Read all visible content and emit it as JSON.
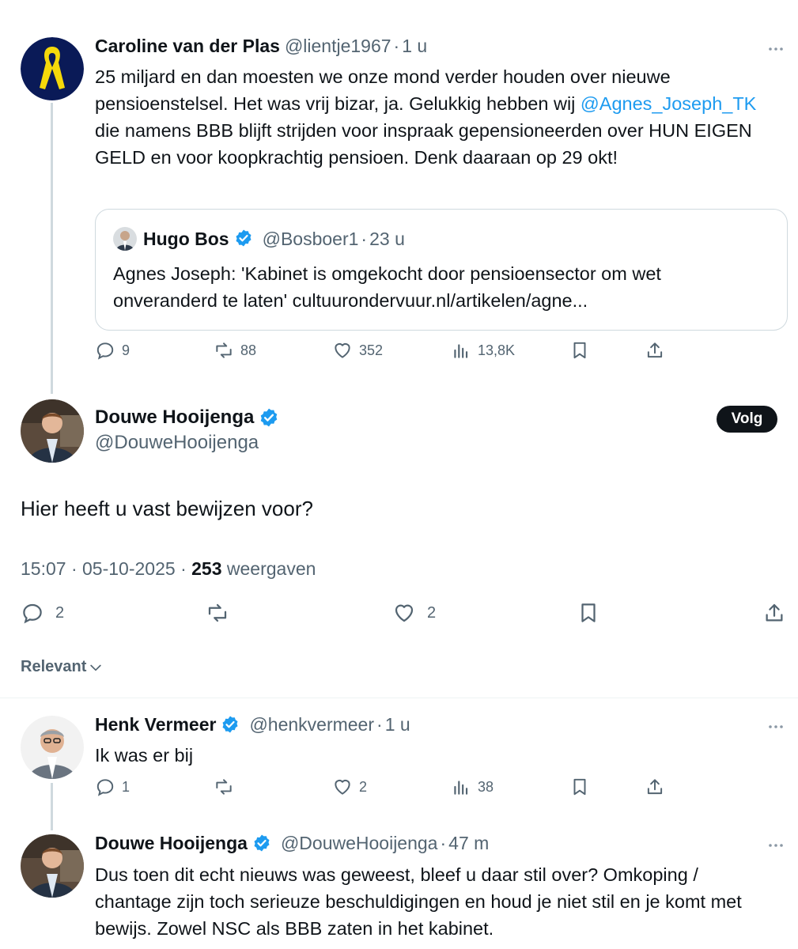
{
  "colors": {
    "accent": "#1d9bf0",
    "text": "#0f1419",
    "muted": "#536471",
    "border": "#cfd9de"
  },
  "post1": {
    "name": "Caroline van der Plas",
    "handle": "@lientje1967",
    "time": "1 u",
    "text_a": "25 miljard en dan moesten we onze mond verder houden over nieuwe pensioenstelsel. Het was vrij bizar, ja. Gelukkig hebben wij ",
    "mention": "@Agnes_Joseph_TK",
    "text_b": " die namens BBB blijft strijden voor inspraak gepensioneerden over HUN EIGEN GELD en voor koopkrachtig pensioen. Denk daaraan op 29 okt!",
    "quote": {
      "name": "Hugo Bos",
      "handle": "@Bosboer1",
      "time": "23 u",
      "text": "Agnes Joseph: 'Kabinet is omgekocht door pensioensector om wet onveranderd te laten'  cultuurondervuur.nl/artikelen/agne..."
    },
    "replies": "9",
    "reposts": "88",
    "likes": "352",
    "views": "13,8K"
  },
  "main_post": {
    "name": "Douwe Hooijenga",
    "handle": "@DouweHooijenga",
    "follow_label": "Volg",
    "text": "Hier heeft u vast bewijzen voor?",
    "time": "15:07",
    "date": "05-10-2025",
    "views_count": "253",
    "views_label": "weergaven",
    "replies": "2",
    "likes": "2"
  },
  "sort": {
    "label": "Relevant"
  },
  "reply1": {
    "name": "Henk Vermeer",
    "handle": "@henkvermeer",
    "time": "1 u",
    "text": "Ik was er bij",
    "replies": "1",
    "likes": "2",
    "views": "38"
  },
  "reply2": {
    "name": "Douwe Hooijenga",
    "handle": "@DouweHooijenga",
    "time": "47 m",
    "text": "Dus toen dit echt nieuws was geweest, bleef u daar stil over? Omkoping / chantage zijn toch serieuze beschuldigingen en houd je niet stil en je komt met bewijs. Zowel NSC als BBB zaten in het kabinet."
  }
}
